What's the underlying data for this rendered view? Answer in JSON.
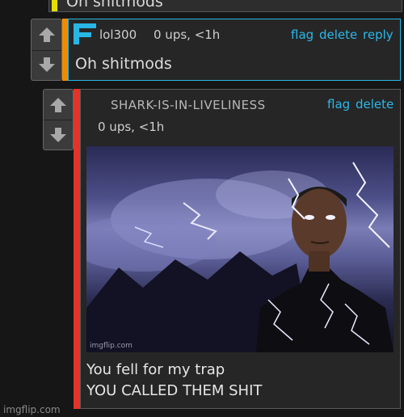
{
  "top_comment": {
    "text": "Oh shitmods"
  },
  "comment1": {
    "username": "lol300",
    "meta": "0 ups, <1h",
    "actions": [
      "flag",
      "delete",
      "reply"
    ],
    "body": "Oh shitmods",
    "stripe_color": "#f08c00",
    "border_color": "#29b6e5"
  },
  "comment2": {
    "username": "SHARK-IS-IN-LIVELINESS",
    "meta": "0 ups, <1h",
    "actions": [
      "flag",
      "delete"
    ],
    "stripe_color": "#e5332a",
    "image": {
      "watermark": "imgflip.com",
      "caption_line1": "You fell for my trap",
      "caption_line2": "YOU CALLED THEM SHIT"
    }
  },
  "footer": {
    "watermark": "imgflip.com"
  },
  "colors": {
    "link": "#2bb8ea",
    "background": "#161616"
  },
  "icons": [
    "up-arrow-icon",
    "down-arrow-icon",
    "user-flair-f-icon"
  ]
}
